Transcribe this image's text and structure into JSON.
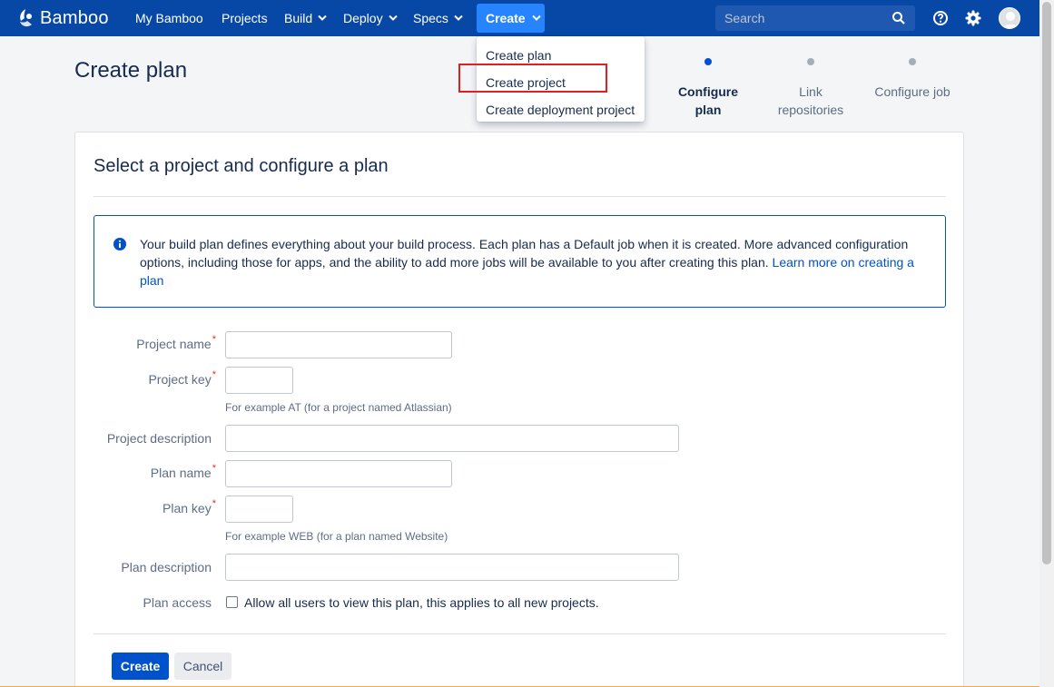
{
  "nav": {
    "brand": "Bamboo",
    "items": [
      "My Bamboo",
      "Projects",
      "Build",
      "Deploy",
      "Specs"
    ],
    "create_label": "Create",
    "search_placeholder": "Search",
    "icons": [
      "bamboo-logo-icon",
      "chevron-down-icon",
      "search-icon",
      "help-icon",
      "gear-icon",
      "avatar"
    ]
  },
  "create_menu": {
    "items": [
      "Create plan",
      "Create project",
      "Create deployment project"
    ],
    "highlighted": "Create project"
  },
  "page": {
    "title": "Create plan"
  },
  "stepper": {
    "steps": [
      "Configure plan",
      "Link repositories",
      "Configure job"
    ],
    "active_step": "Configure plan"
  },
  "form": {
    "heading": "Select a project and configure a plan",
    "info_text": "Your build plan defines everything about your build process. Each plan has a Default job when it is created. More advanced configuration options, including those for apps, and the ability to add more jobs will be available to you after creating this plan.",
    "info_link": "Learn more on creating a plan",
    "fields": {
      "project_name": {
        "label": "Project name",
        "value": ""
      },
      "project_key": {
        "label": "Project key",
        "value": "",
        "hint": "For example AT (for a project named Atlassian)"
      },
      "project_description": {
        "label": "Project description",
        "value": ""
      },
      "plan_name": {
        "label": "Plan name",
        "value": ""
      },
      "plan_key": {
        "label": "Plan key",
        "value": "",
        "hint": "For example WEB (for a plan named Website)"
      },
      "plan_description": {
        "label": "Plan description",
        "value": ""
      }
    },
    "plan_access": {
      "label": "Plan access",
      "checkbox_label": "Allow all users to view this plan, this applies to all new projects.",
      "checked": false
    },
    "buttons": {
      "create": "Create",
      "cancel": "Cancel"
    }
  },
  "colors": {
    "nav_bg": "#0747a6",
    "create_button": "#2684ff",
    "primary": "#0052cc",
    "highlight_box": "#e02020",
    "required_asterisk": "#de350b"
  }
}
